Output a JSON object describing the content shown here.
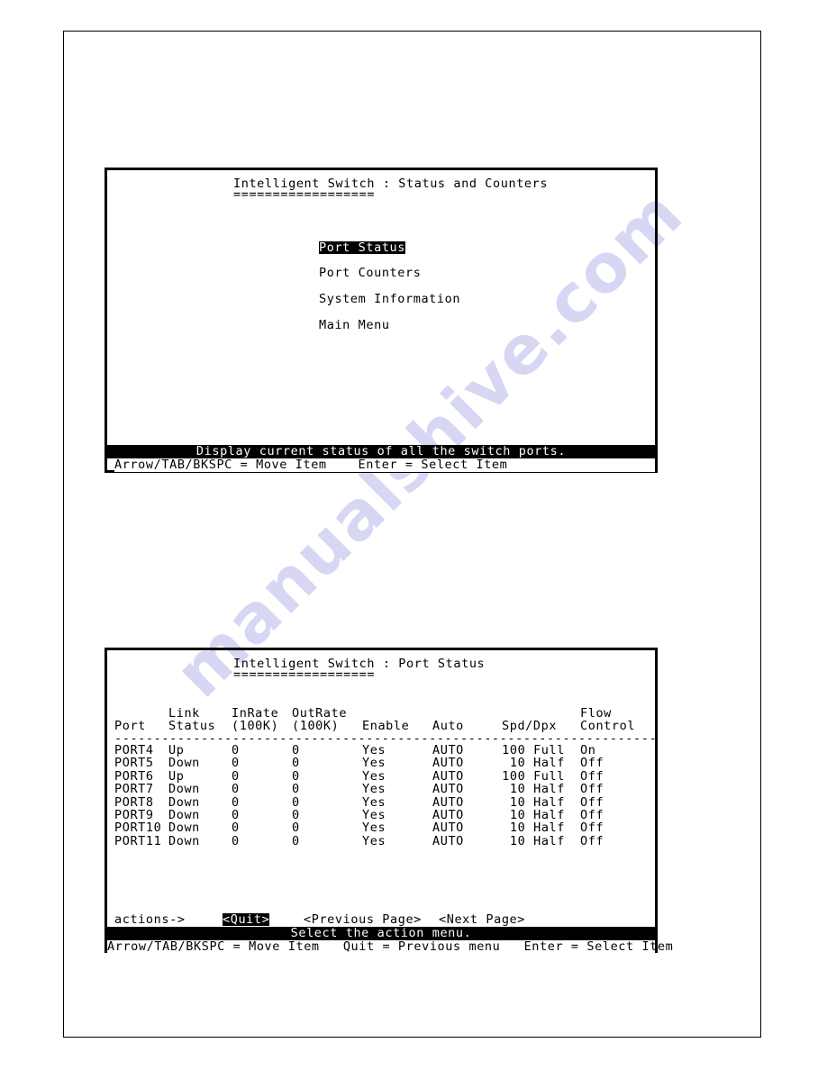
{
  "watermark": {
    "text": "manualshive.com"
  },
  "colors": {
    "foreground": "#000000",
    "background": "#ffffff",
    "watermark": "#d7d7f4"
  },
  "screens": [
    {
      "name": "status-and-counters-menu",
      "title": "Intelligent Switch : Status and Counters",
      "title_underline": "==================",
      "menu_items": [
        {
          "label": "Port Status",
          "selected": true
        },
        {
          "label": "Port Counters",
          "selected": false
        },
        {
          "label": "System Information",
          "selected": false
        },
        {
          "label": "Main Menu",
          "selected": false
        }
      ],
      "statusbar": "Display current status of all the switch ports.",
      "helpline": "Arrow/TAB/BKSPC = Move Item    Enter = Select Item"
    },
    {
      "name": "port-status-screen",
      "title": "Intelligent Switch : Port Status",
      "title_underline": "==================",
      "table": {
        "headers_top": [
          "",
          "Link",
          "InRate",
          "OutRate",
          "",
          "",
          "",
          "Flow"
        ],
        "headers_bottom": [
          "Port",
          "Status",
          "(100K)",
          "(100K)",
          "Enable",
          "Auto",
          "Spd/Dpx",
          "Control"
        ],
        "separator": "---------------------------------------------------------------------",
        "rows": [
          {
            "port": "PORT4",
            "link_status": "Up",
            "in_rate": "0",
            "out_rate": "0",
            "enable": "Yes",
            "auto": "AUTO",
            "spd_dpx": "100 Full",
            "flow_control": "On"
          },
          {
            "port": "PORT5",
            "link_status": "Down",
            "in_rate": "0",
            "out_rate": "0",
            "enable": "Yes",
            "auto": "AUTO",
            "spd_dpx": "10 Half",
            "flow_control": "Off"
          },
          {
            "port": "PORT6",
            "link_status": "Up",
            "in_rate": "0",
            "out_rate": "0",
            "enable": "Yes",
            "auto": "AUTO",
            "spd_dpx": "100 Full",
            "flow_control": "Off"
          },
          {
            "port": "PORT7",
            "link_status": "Down",
            "in_rate": "0",
            "out_rate": "0",
            "enable": "Yes",
            "auto": "AUTO",
            "spd_dpx": "10 Half",
            "flow_control": "Off"
          },
          {
            "port": "PORT8",
            "link_status": "Down",
            "in_rate": "0",
            "out_rate": "0",
            "enable": "Yes",
            "auto": "AUTO",
            "spd_dpx": "10 Half",
            "flow_control": "Off"
          },
          {
            "port": "PORT9",
            "link_status": "Down",
            "in_rate": "0",
            "out_rate": "0",
            "enable": "Yes",
            "auto": "AUTO",
            "spd_dpx": "10 Half",
            "flow_control": "Off"
          },
          {
            "port": "PORT10",
            "link_status": "Down",
            "in_rate": "0",
            "out_rate": "0",
            "enable": "Yes",
            "auto": "AUTO",
            "spd_dpx": "10 Half",
            "flow_control": "Off"
          },
          {
            "port": "PORT11",
            "link_status": "Down",
            "in_rate": "0",
            "out_rate": "0",
            "enable": "Yes",
            "auto": "AUTO",
            "spd_dpx": "10 Half",
            "flow_control": "Off"
          }
        ]
      },
      "actions": {
        "label": "actions->",
        "items": [
          {
            "label": "<Quit>",
            "selected": true
          },
          {
            "label": "<Previous Page>",
            "selected": false
          },
          {
            "label": "<Next Page>",
            "selected": false
          }
        ]
      },
      "statusbar": "Select the action menu.",
      "helpline": "Arrow/TAB/BKSPC = Move Item   Quit = Previous menu   Enter = Select Item"
    }
  ]
}
